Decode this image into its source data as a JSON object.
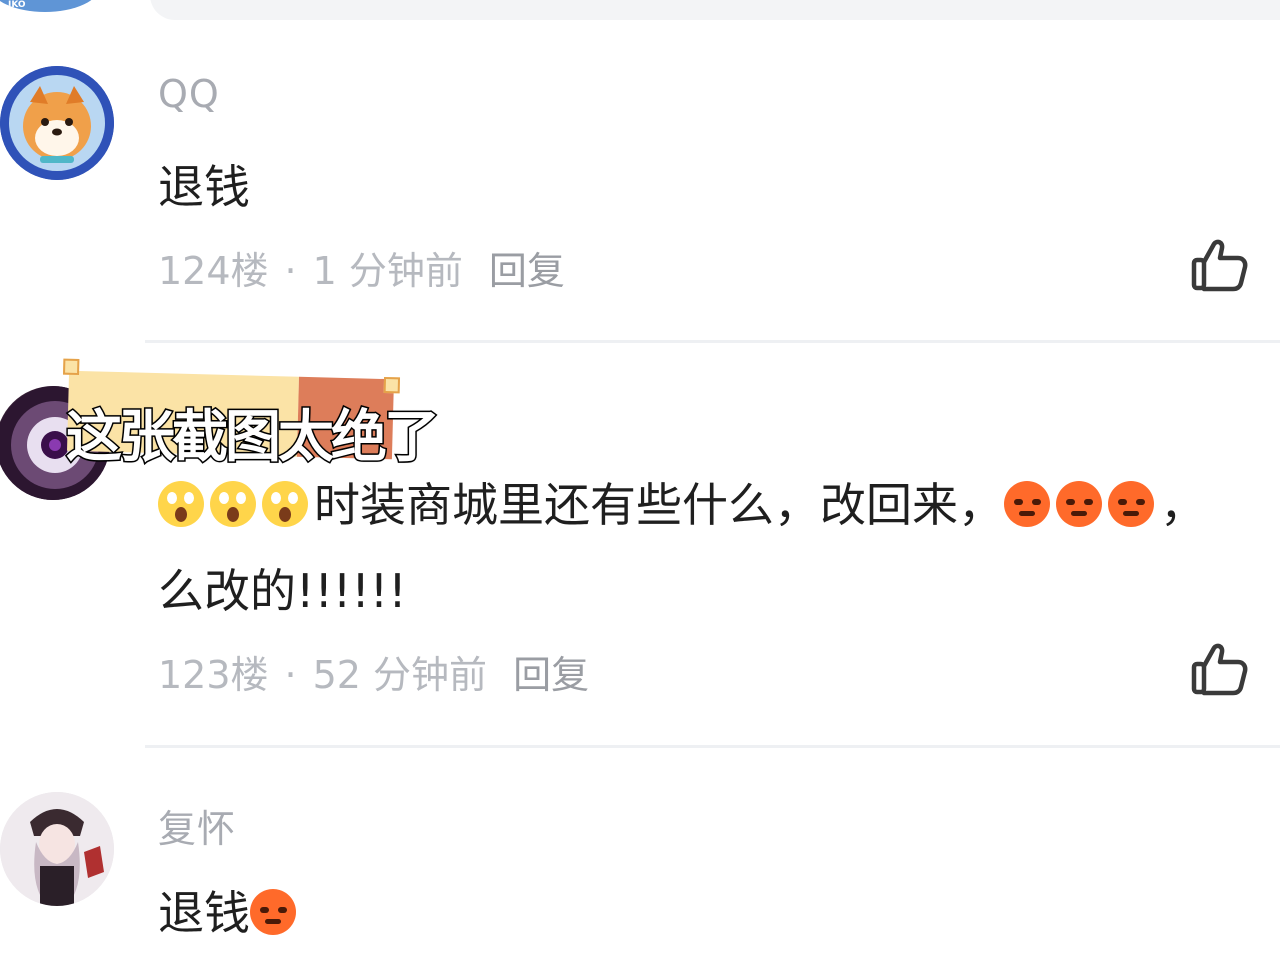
{
  "comments": [
    {
      "username": "QQ",
      "content": "退钱",
      "floor": "124楼",
      "time": "1 分钟前",
      "reply": "回复"
    },
    {
      "username": "",
      "content_line1": "时装商城里还有些什么，改回来，",
      "content_line1_tail": "，",
      "content_line2": "么改的!!!!!!",
      "floor": "123楼",
      "time": "52 分钟前",
      "reply": "回复"
    },
    {
      "username": "复怀",
      "content": "退钱"
    }
  ],
  "meta_separator": "·",
  "overlay_caption": "这张截图太绝了",
  "colors": {
    "username": "#a8abb2",
    "meta": "#b6b9bf",
    "caption_highlight": "#fbe3a6",
    "caption_accent": "#dd7d5a"
  },
  "icons": {
    "like": "thumbs-up-icon",
    "scream_emoji": "face-screaming-emoji",
    "angry_emoji": "angry-face-emoji"
  }
}
